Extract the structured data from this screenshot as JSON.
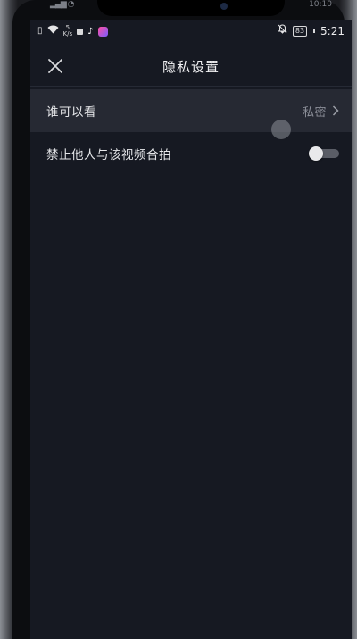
{
  "outer_status": {
    "time": "10:10"
  },
  "status_bar": {
    "network_speed": "5\nK/s",
    "battery": "83",
    "time": "5:21"
  },
  "header": {
    "title": "隐私设置",
    "close_icon": "close-icon"
  },
  "settings": {
    "who_can_view": {
      "label": "谁可以看",
      "value": "私密"
    },
    "disable_duet": {
      "label": "禁止他人与该视频合拍",
      "toggle_on": false
    }
  },
  "colors": {
    "background": "#161922",
    "selected_row": "#262933",
    "text_primary": "#e6e7ea",
    "text_secondary": "#8d909a",
    "toggle_off_track": "#5a5d66"
  }
}
